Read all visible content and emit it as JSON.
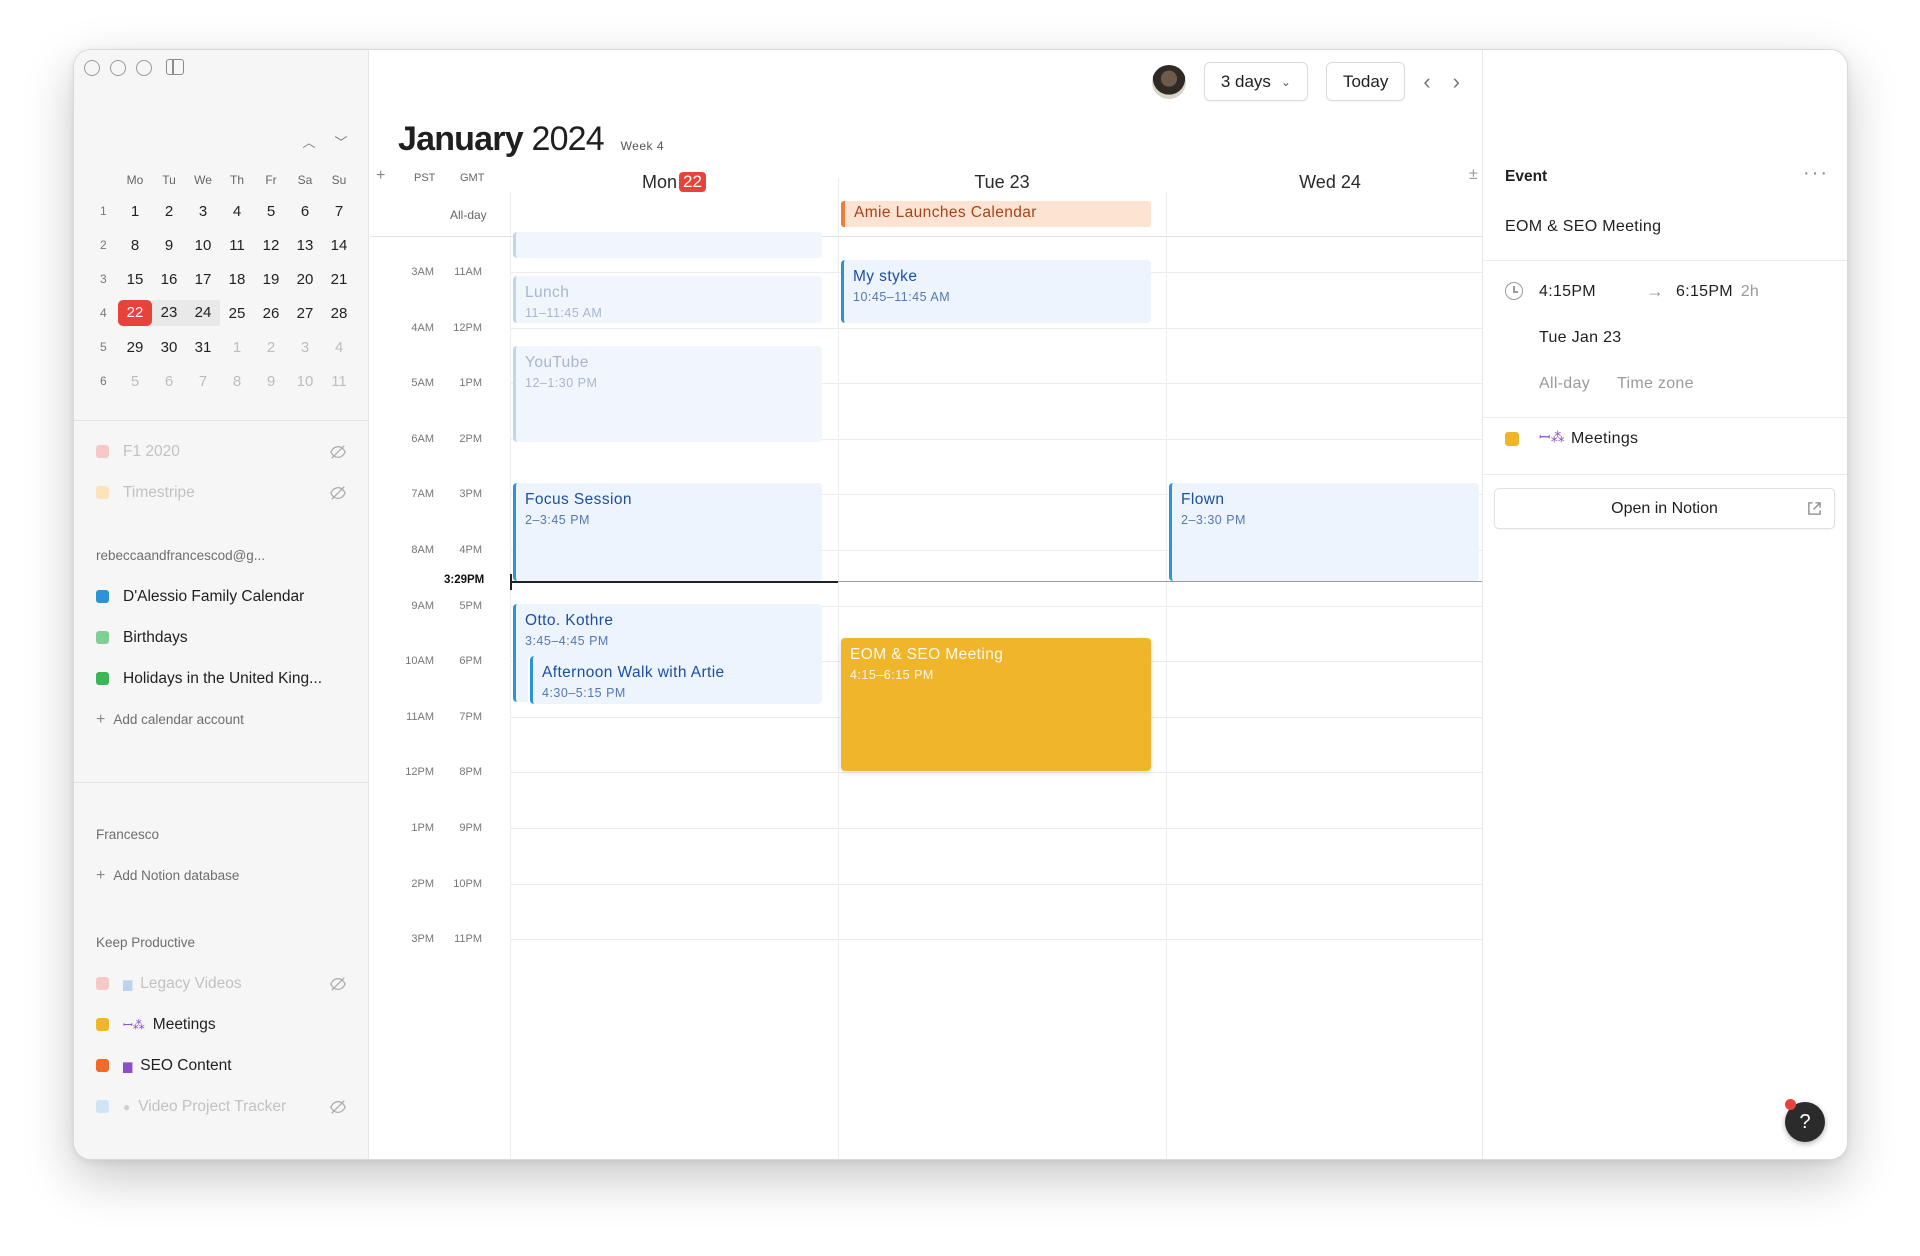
{
  "sidebar": {
    "mini_calendar": {
      "weekdays": [
        "Mo",
        "Tu",
        "We",
        "Th",
        "Fr",
        "Sa",
        "Su"
      ],
      "weeks": [
        {
          "wk": "1",
          "days": [
            "1",
            "2",
            "3",
            "4",
            "5",
            "6",
            "7"
          ]
        },
        {
          "wk": "2",
          "days": [
            "8",
            "9",
            "10",
            "11",
            "12",
            "13",
            "14"
          ]
        },
        {
          "wk": "3",
          "days": [
            "15",
            "16",
            "17",
            "18",
            "19",
            "20",
            "21"
          ]
        },
        {
          "wk": "4",
          "days": [
            "22",
            "23",
            "24",
            "25",
            "26",
            "27",
            "28"
          ]
        },
        {
          "wk": "5",
          "days": [
            "29",
            "30",
            "31",
            "1",
            "2",
            "3",
            "4"
          ]
        },
        {
          "wk": "6",
          "days": [
            "5",
            "6",
            "7",
            "8",
            "9",
            "10",
            "11"
          ]
        }
      ]
    },
    "hidden_calendars": [
      "F1 2020",
      "Timestripe"
    ],
    "account_label": "rebeccaandfrancescod@g...",
    "account_calendars": [
      "D'Alessio Family Calendar",
      "Birthdays",
      "Holidays in the United King..."
    ],
    "add_calendar_label": "Add calendar account",
    "notion_owner_label": "Francesco",
    "add_notion_label": "Add Notion database",
    "workspace_label": "Keep Productive",
    "notion_dbs": [
      "Legacy Videos",
      "Meetings",
      "SEO Content",
      "Video Project Tracker"
    ]
  },
  "toolbar": {
    "view_label": "3 days",
    "today_label": "Today"
  },
  "header": {
    "month": "January",
    "year": "2024",
    "week": "Week 4"
  },
  "days": {
    "mon_label": "Mon",
    "mon_num": "22",
    "tue": "Tue 23",
    "wed": "Wed 24"
  },
  "timezones": {
    "add": "+",
    "primary": "PST",
    "secondary": "GMT",
    "allday": "All-day",
    "pst_hours": [
      "3AM",
      "4AM",
      "5AM",
      "6AM",
      "7AM",
      "8AM",
      "9AM",
      "10AM",
      "11AM",
      "12PM",
      "1PM",
      "2PM",
      "3PM"
    ],
    "gmt_hours": [
      "11AM",
      "12PM",
      "1PM",
      "2PM",
      "3PM",
      "4PM",
      "5PM",
      "6PM",
      "7PM",
      "8PM",
      "9PM",
      "10PM",
      "11PM"
    ],
    "now": "3:29PM"
  },
  "events": {
    "allday_tue": "Amie Launches Calendar",
    "lunch": {
      "title": "Lunch",
      "time": "11–11:45 AM"
    },
    "youtube": {
      "title": "YouTube",
      "time": "12–1:30 PM"
    },
    "focus": {
      "title": "Focus Session",
      "time": "2–3:45 PM"
    },
    "otto": {
      "title": "Otto. Kothre",
      "time": "3:45–4:45 PM"
    },
    "walk": {
      "title": "Afternoon Walk with Artie",
      "time": "4:30–5:15 PM"
    },
    "mystyke": {
      "title": "My styke",
      "time": "10:45–11:45 AM"
    },
    "eom": {
      "title": "EOM & SEO Meeting",
      "time": "4:15–6:15 PM"
    },
    "flown": {
      "title": "Flown",
      "time": "2–3:30 PM"
    }
  },
  "panel": {
    "heading": "Event",
    "more": "···",
    "title": "EOM & SEO Meeting",
    "start": "4:15PM",
    "end": "6:15PM",
    "duration": "2h",
    "date": "Tue Jan 23",
    "allday": "All-day",
    "timezone": "Time zone",
    "calendar": "Meetings",
    "open_label": "Open in Notion"
  },
  "colors": {
    "accent_red": "#e8433a",
    "event_blue": "#2a94d4",
    "event_yellow": "#f0b62b",
    "allday_orange": "#ef7c3a",
    "meetings": "#f0b62b",
    "seo": "#f06a2a"
  },
  "icons": [
    "chevron-up-icon",
    "chevron-down-icon",
    "eye-off-icon",
    "plus-icon",
    "chevron-left-icon",
    "chevron-right-icon",
    "clock-icon",
    "arrow-right-icon",
    "external-link-icon",
    "help-icon",
    "meetings-people-icon",
    "document-icon"
  ],
  "help": "?"
}
